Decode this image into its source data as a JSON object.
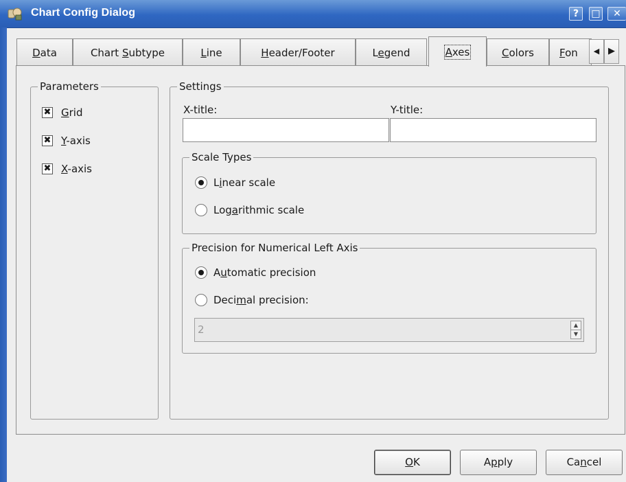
{
  "window": {
    "title": "Chart Config Dialog",
    "icon": "chart-config-app-icon",
    "controls": {
      "help": "?",
      "maximize": "□",
      "close": "✕"
    }
  },
  "tabs": [
    {
      "pre": "",
      "u": "D",
      "post": "ata",
      "active": false
    },
    {
      "pre": "Chart ",
      "u": "S",
      "post": "ubtype",
      "active": false
    },
    {
      "pre": "",
      "u": "L",
      "post": "ine",
      "active": false
    },
    {
      "pre": "",
      "u": "H",
      "post": "eader/Footer",
      "active": false
    },
    {
      "pre": "L",
      "u": "e",
      "post": "gend",
      "active": false
    },
    {
      "pre": "",
      "u": "A",
      "post": "xes",
      "active": true
    },
    {
      "pre": "",
      "u": "C",
      "post": "olors",
      "active": false
    },
    {
      "pre": "",
      "u": "F",
      "post": "on",
      "active": false
    }
  ],
  "tab_scroll": {
    "left_icon": "scroll-left-icon",
    "right_icon": "scroll-right-icon"
  },
  "parameters": {
    "title": "Parameters",
    "grid": {
      "pre": "",
      "u": "G",
      "post": "rid",
      "checked": true
    },
    "y_axis": {
      "pre": "",
      "u": "Y",
      "post": "-axis",
      "checked": true
    },
    "x_axis": {
      "pre": "",
      "u": "X",
      "post": "-axis",
      "checked": true
    }
  },
  "settings": {
    "title": "Settings",
    "x_title_label": "X-title:",
    "x_title_value": "",
    "y_title_label": "Y-title:",
    "y_title_value": ""
  },
  "scale_types": {
    "title": "Scale Types",
    "linear": {
      "pre": "L",
      "u": "i",
      "post": "near scale",
      "selected": true
    },
    "logarithmic": {
      "pre": "Log",
      "u": "a",
      "post": "rithmic scale",
      "selected": false
    }
  },
  "precision": {
    "title": "Precision for Numerical Left Axis",
    "automatic": {
      "pre": "A",
      "u": "u",
      "post": "tomatic precision",
      "selected": true
    },
    "decimal": {
      "pre": "Deci",
      "u": "m",
      "post": "al precision:",
      "selected": false
    },
    "spin_value": "2"
  },
  "buttons": {
    "ok": {
      "pre": "",
      "u": "O",
      "post": "K"
    },
    "apply": {
      "pre": "A",
      "u": "p",
      "post": "ply"
    },
    "cancel": {
      "pre": "Ca",
      "u": "n",
      "post": "cel"
    }
  }
}
